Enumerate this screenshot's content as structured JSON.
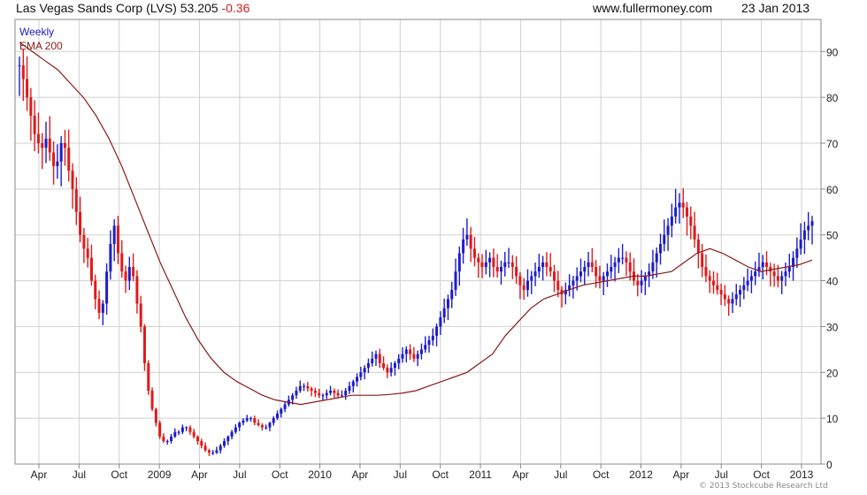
{
  "header": {
    "symbol": "Las Vegas Sands Corp (LVS)",
    "price": "53.205",
    "change": "-0.36",
    "site": "www.fullermoney.com",
    "date": "23 Jan 2013"
  },
  "legend": {
    "period": "Weekly",
    "ema": "EMA 200"
  },
  "credit": "© 2013 Stockcube Research Ltd",
  "colors": {
    "up": "#1c1ccc",
    "down": "#e01a1a",
    "ema": "#8b1a1a",
    "grid": "#d0d0d0",
    "frame": "#888888"
  },
  "chart_data": {
    "type": "line",
    "title": "Las Vegas Sands Corp (LVS) 53.205 -0.36",
    "ylim": [
      0,
      97
    ],
    "yticks": [
      0,
      10,
      20,
      30,
      40,
      50,
      60,
      70,
      80,
      90
    ],
    "xticks": [
      "Apr",
      "Jul",
      "Oct",
      "2009",
      "Apr",
      "Jul",
      "Oct",
      "2010",
      "Apr",
      "Jul",
      "Oct",
      "2011",
      "Apr",
      "Jul",
      "Oct",
      "2012",
      "Apr",
      "Jul",
      "Oct",
      "2013"
    ],
    "grid": true,
    "legend_position": "top-left",
    "series": [
      {
        "name": "Weekly",
        "style": "candles",
        "values": [
          87,
          84,
          80,
          76,
          72,
          70,
          69,
          71,
          68,
          65,
          66,
          70,
          69,
          64,
          60,
          55,
          50,
          47,
          45,
          40,
          36,
          33,
          35,
          42,
          48,
          52,
          46,
          42,
          40,
          43,
          41,
          35,
          30,
          22,
          16,
          12,
          9,
          6,
          5,
          5,
          6,
          7,
          7,
          8,
          8,
          7,
          6,
          5,
          4,
          3,
          2.5,
          2.5,
          3,
          4,
          5,
          6,
          7,
          8,
          9,
          9.5,
          10,
          10,
          9,
          8.5,
          8,
          8,
          9,
          10,
          11,
          12,
          13,
          14,
          15,
          16,
          17,
          17,
          16.5,
          16,
          15.5,
          15,
          15,
          15.5,
          16,
          15.5,
          15,
          15,
          16,
          17,
          18,
          19,
          20,
          21,
          22,
          23,
          24,
          22,
          21,
          20,
          21,
          22,
          23,
          24,
          25,
          24,
          23,
          24,
          25,
          26,
          27,
          28,
          30,
          32,
          34,
          36,
          38,
          42,
          46,
          49,
          50,
          47,
          45,
          44,
          43,
          44,
          45,
          43,
          42,
          43,
          44,
          44,
          43,
          41,
          39,
          38,
          40,
          41,
          42,
          43,
          44,
          43,
          42,
          40,
          38,
          37,
          38,
          39,
          40,
          41,
          42,
          43,
          44,
          43,
          41,
          40,
          41,
          42,
          43,
          44,
          45,
          45,
          44,
          42,
          40,
          39,
          40,
          41,
          42,
          44,
          46,
          48,
          50,
          52,
          54,
          56,
          57,
          56,
          54,
          52,
          49,
          46,
          43,
          41,
          40,
          39,
          38,
          37,
          36,
          35,
          36,
          37,
          38,
          39,
          40,
          41,
          42,
          43,
          44,
          43,
          42,
          41,
          40,
          41,
          42,
          43,
          45,
          47,
          49,
          51,
          52,
          53
        ]
      },
      {
        "name": "EMA 200",
        "style": "line",
        "values": [
          92,
          90,
          88,
          86,
          83,
          80,
          76,
          71,
          65,
          58,
          51,
          44,
          38,
          32,
          27,
          23,
          20,
          18,
          16.5,
          15,
          14,
          13.5,
          13,
          13.5,
          14,
          14.5,
          15,
          15,
          15,
          15.2,
          15.5,
          16,
          17,
          18,
          19,
          20,
          22,
          24,
          28,
          31,
          34,
          36,
          37,
          38,
          39,
          39.5,
          40,
          40.5,
          41,
          41,
          41.5,
          42,
          44,
          46,
          47,
          46,
          44.5,
          43,
          42,
          42.5,
          43,
          43.5,
          44.5
        ]
      }
    ]
  }
}
